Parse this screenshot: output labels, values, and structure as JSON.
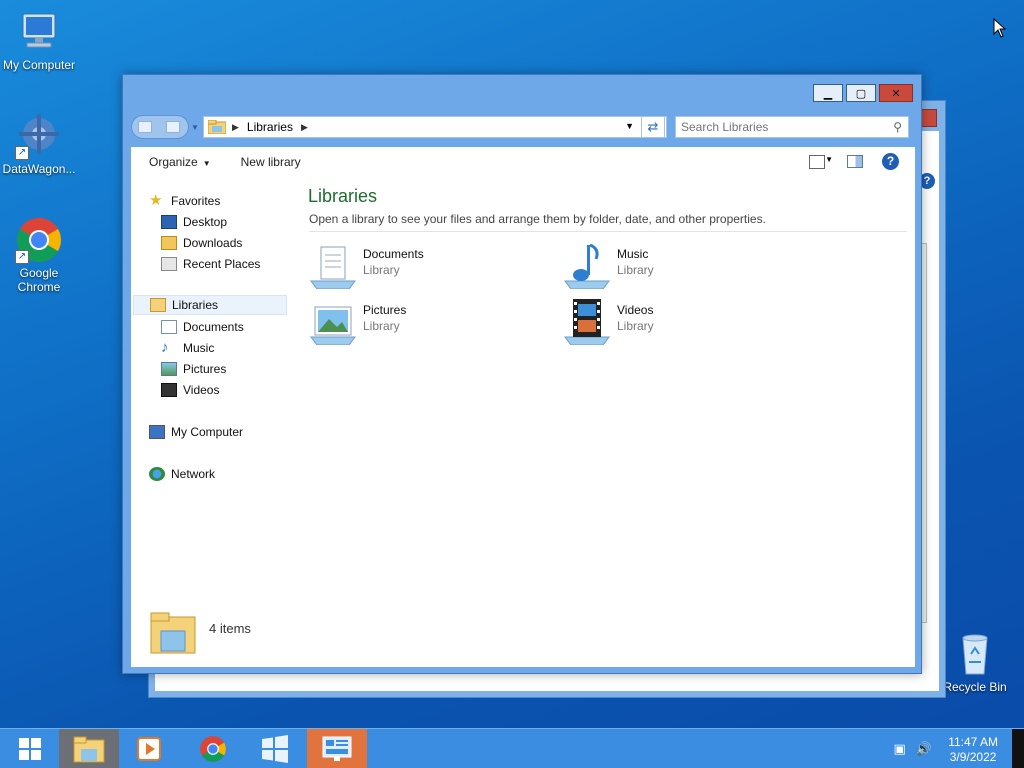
{
  "desktop": {
    "icons": [
      {
        "label": "My Computer"
      },
      {
        "label": "DataWagon..."
      },
      {
        "label": "Google Chrome"
      },
      {
        "label": "Recycle Bin"
      }
    ]
  },
  "window": {
    "address": {
      "crumbs": [
        "Libraries"
      ]
    },
    "search": {
      "placeholder": "Search Libraries"
    },
    "toolbar": {
      "organize": "Organize",
      "new_library": "New library"
    },
    "nav": {
      "favorites": "Favorites",
      "desktop": "Desktop",
      "downloads": "Downloads",
      "recent_places": "Recent Places",
      "libraries": "Libraries",
      "documents": "Documents",
      "music": "Music",
      "pictures": "Pictures",
      "videos": "Videos",
      "my_computer": "My Computer",
      "network": "Network"
    },
    "content": {
      "title": "Libraries",
      "description": "Open a library to see your files and arrange them by folder, date, and other properties.",
      "items": [
        {
          "name": "Documents",
          "type": "Library"
        },
        {
          "name": "Music",
          "type": "Library"
        },
        {
          "name": "Pictures",
          "type": "Library"
        },
        {
          "name": "Videos",
          "type": "Library"
        }
      ]
    },
    "details": {
      "count": "4 items"
    }
  },
  "taskbar": {
    "time": "11:47 AM",
    "date": "3/9/2022"
  },
  "colors": {
    "accent": "#1e6c2f",
    "window_frame": "#6fa8e8",
    "taskbar": "#3a8de0",
    "close": "#c9493a"
  }
}
